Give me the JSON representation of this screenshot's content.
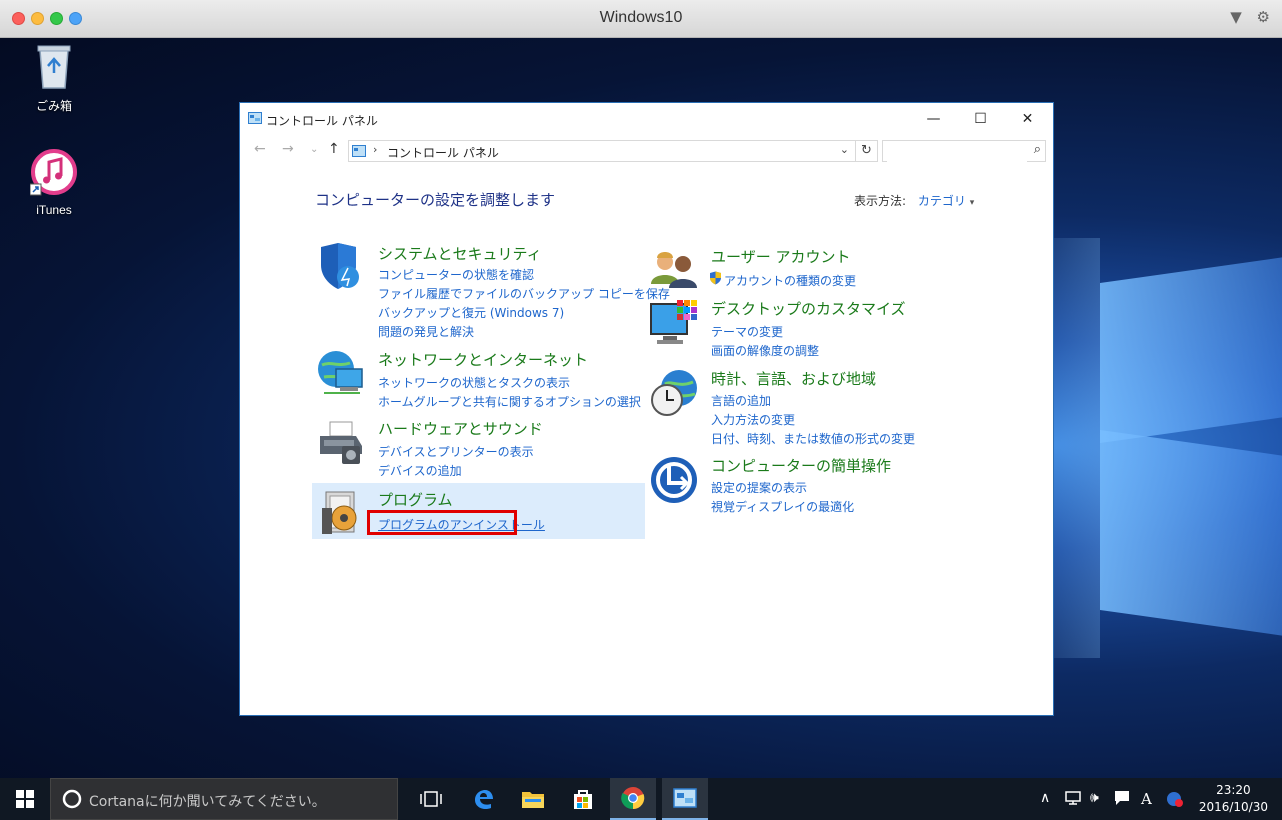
{
  "mac": {
    "title": "Windows10"
  },
  "desktop": {
    "icons": [
      {
        "label": "ごみ箱",
        "icon": "recycle-bin-icon"
      },
      {
        "label": "iTunes",
        "icon": "itunes-icon"
      }
    ]
  },
  "window": {
    "title": "コントロール パネル",
    "address": "コントロール パネル",
    "search_placeholder": "",
    "heading": "コンピューターの設定を調整します",
    "viewby_label": "表示方法:",
    "viewby_value": "カテゴリ"
  },
  "categories_left": [
    {
      "title": "システムとセキュリティ",
      "icon": "shield-icon",
      "links": [
        "コンピューターの状態を確認",
        "ファイル履歴でファイルのバックアップ コピーを保存",
        "バックアップと復元 (Windows 7)",
        "問題の発見と解決"
      ]
    },
    {
      "title": "ネットワークとインターネット",
      "icon": "network-icon",
      "links": [
        "ネットワークの状態とタスクの表示",
        "ホームグループと共有に関するオプションの選択"
      ]
    },
    {
      "title": "ハードウェアとサウンド",
      "icon": "printer-icon",
      "links": [
        "デバイスとプリンターの表示",
        "デバイスの追加"
      ]
    },
    {
      "title": "プログラム",
      "icon": "programs-icon",
      "links": [
        "プログラムのアンインストール"
      ]
    }
  ],
  "categories_right": [
    {
      "title": "ユーザー アカウント",
      "icon": "users-icon",
      "links": [
        "アカウントの種類の変更"
      ]
    },
    {
      "title": "デスクトップのカスタマイズ",
      "icon": "monitor-icon",
      "links": [
        "テーマの変更",
        "画面の解像度の調整"
      ]
    },
    {
      "title": "時計、言語、および地域",
      "icon": "clock-globe-icon",
      "links": [
        "言語の追加",
        "入力方法の変更",
        "日付、時刻、または数値の形式の変更"
      ]
    },
    {
      "title": "コンピューターの簡単操作",
      "icon": "ease-of-access-icon",
      "links": [
        "設定の提案の表示",
        "視覚ディスプレイの最適化"
      ]
    }
  ],
  "taskbar": {
    "cortana_text": "Cortanaに何か聞いてみてください。",
    "time": "23:20",
    "date": "2016/10/30",
    "ime": "A"
  }
}
